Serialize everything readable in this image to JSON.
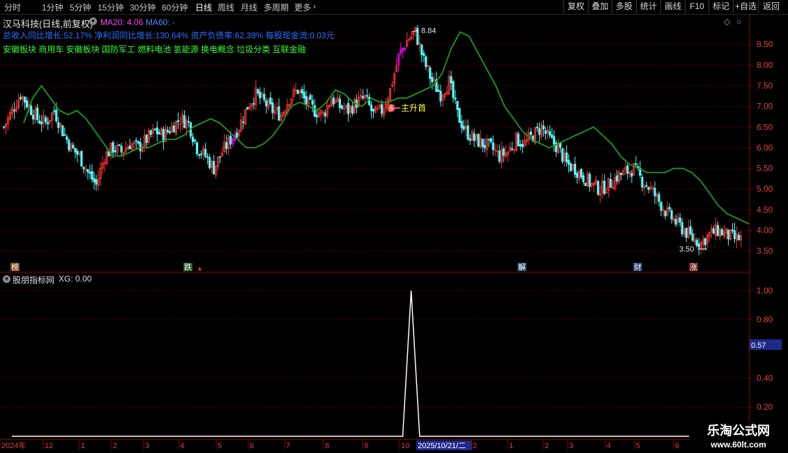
{
  "toolbar": {
    "periods": [
      "分时",
      "1分钟",
      "5分钟",
      "15分钟",
      "30分钟",
      "60分钟",
      "日线",
      "周线",
      "月线",
      "多周期",
      "更多"
    ],
    "active_period": "日线",
    "right_buttons": [
      "复权",
      "叠加",
      "多股",
      "统计",
      "画线",
      "F10",
      "标记",
      "+自选",
      "返回"
    ]
  },
  "header": {
    "stock_title": "汉马科技(日线,前复权)",
    "ma20_label": "MA20: 4.06",
    "ma60_label": "MA60: -",
    "fundamentals": "总收入同比增长:52.17% 净利润同比增长:130.64% 资产负债率:62.39% 每股现金流:0.03元",
    "concepts": "安徽板块 商用车 安徽板块 国防军工 燃料电池 氢能源 换电概念 垃圾分类 互联金融"
  },
  "annotations": {
    "high_label": "8.84",
    "low_label": "3.50",
    "signal_marker": "多",
    "signal_text": "主升首"
  },
  "event_markers": [
    "榜",
    "跌",
    "解",
    "财",
    "涨"
  ],
  "indicator": {
    "title": "股朋指标网",
    "xg_label": "XG: 0.00",
    "cursor_value": "0.57"
  },
  "time_axis": {
    "labels": [
      "2024年",
      "12",
      "1",
      "2",
      "3",
      "4",
      "5",
      "6",
      "7",
      "8",
      "9",
      "10",
      "2025/10/21/二",
      "2",
      "1",
      "2",
      "3",
      "4",
      "5",
      "6"
    ]
  },
  "watermark": {
    "title": "乐淘公式网",
    "url": "www.60lt.com"
  },
  "colors": {
    "up": "#ff3232",
    "down": "#54ffff",
    "ma_line": "#1e9b1e",
    "signal": "#ff00ff",
    "grid": "#8b0000"
  },
  "chart_data": [
    {
      "type": "candlestick",
      "title": "汉马科技(日线,前复权)",
      "ylim": [
        3.3,
        8.9
      ],
      "y_ticks": [
        3.5,
        4.0,
        4.5,
        5.0,
        5.5,
        6.0,
        6.5,
        7.0,
        7.5,
        8.0,
        8.5
      ],
      "close_approx": [
        6.5,
        6.9,
        7.3,
        7.0,
        6.7,
        6.6,
        6.9,
        6.4,
        6.0,
        5.8,
        5.4,
        5.1,
        5.8,
        6.0,
        5.9,
        6.1,
        6.0,
        6.2,
        6.4,
        6.3,
        6.5,
        6.7,
        6.6,
        6.0,
        5.8,
        5.5,
        5.9,
        6.2,
        6.5,
        7.0,
        7.3,
        7.1,
        6.9,
        6.8,
        7.2,
        7.4,
        7.1,
        6.9,
        6.8,
        7.2,
        7.0,
        6.9,
        7.1,
        7.2,
        6.8,
        6.9,
        7.4,
        8.2,
        8.6,
        8.8,
        8.1,
        7.6,
        7.3,
        7.6,
        6.8,
        6.4,
        6.2,
        6.1,
        6.0,
        5.8,
        5.9,
        6.2,
        6.1,
        6.3,
        6.5,
        6.2,
        6.0,
        5.6,
        5.5,
        5.3,
        5.1,
        5.0,
        5.1,
        5.3,
        5.4,
        5.5,
        5.2,
        5.0,
        4.7,
        4.4,
        4.2,
        4.0,
        3.8,
        3.7,
        3.9,
        4.0,
        3.9,
        3.8
      ],
      "series": [
        {
          "name": "MA20",
          "values": [
            6.6,
            7.2,
            7.5,
            7.2,
            6.9,
            6.8,
            6.9,
            6.7,
            6.4,
            6.1,
            5.8,
            5.8,
            5.9,
            6.0,
            6.0,
            6.1,
            6.2,
            6.2,
            6.3,
            6.5,
            6.6,
            6.7,
            6.6,
            6.4,
            6.2,
            6.0,
            6.0,
            6.1,
            6.3,
            6.6,
            7.0,
            7.1,
            7.0,
            6.9,
            7.1,
            7.4,
            7.3,
            7.1,
            7.0,
            7.2,
            7.1,
            7.1,
            7.2,
            7.2,
            7.3,
            7.4,
            7.5,
            7.8,
            8.4,
            8.8,
            8.7,
            8.3,
            7.9,
            7.5,
            7.0,
            6.7,
            6.4,
            6.2,
            6.1,
            6.0,
            6.1,
            6.2,
            6.3,
            6.4,
            6.5,
            6.3,
            6.1,
            5.8,
            5.6,
            5.5,
            5.4,
            5.4,
            5.4,
            5.5,
            5.5,
            5.4,
            5.2,
            4.9,
            4.6,
            4.4,
            4.3,
            4.2,
            4.1,
            4.1
          ]
        }
      ],
      "x_labels": [
        "2024年",
        "12",
        "1",
        "2",
        "3",
        "4",
        "5",
        "6",
        "7",
        "8",
        "9",
        "10",
        "2025/10/21/二",
        "2",
        "1",
        "2",
        "3",
        "4",
        "5",
        "6"
      ]
    },
    {
      "type": "line",
      "title": "股朋指标网",
      "ylim": [
        0,
        1.1
      ],
      "y_ticks": [
        0.2,
        0.4,
        0.8,
        1.0
      ],
      "series": [
        {
          "name": "XG",
          "values": [
            0,
            0,
            0,
            0,
            0,
            0,
            0,
            0,
            0,
            0,
            0,
            0,
            0,
            0,
            0,
            0,
            0,
            0,
            0,
            0,
            0,
            0,
            0,
            0,
            0,
            0,
            0,
            0,
            0,
            0,
            0,
            0,
            0,
            0,
            0,
            0,
            0,
            0,
            0,
            0,
            0,
            0,
            0,
            0,
            0,
            0,
            0,
            1,
            0,
            0,
            0,
            0,
            0,
            0,
            0,
            0,
            0,
            0,
            0,
            0,
            0,
            0,
            0,
            0,
            0,
            0,
            0,
            0,
            0,
            0,
            0,
            0,
            0,
            0,
            0,
            0,
            0,
            0,
            0,
            0,
            0,
            0,
            0,
            0,
            0,
            0,
            0,
            0
          ]
        }
      ]
    }
  ]
}
